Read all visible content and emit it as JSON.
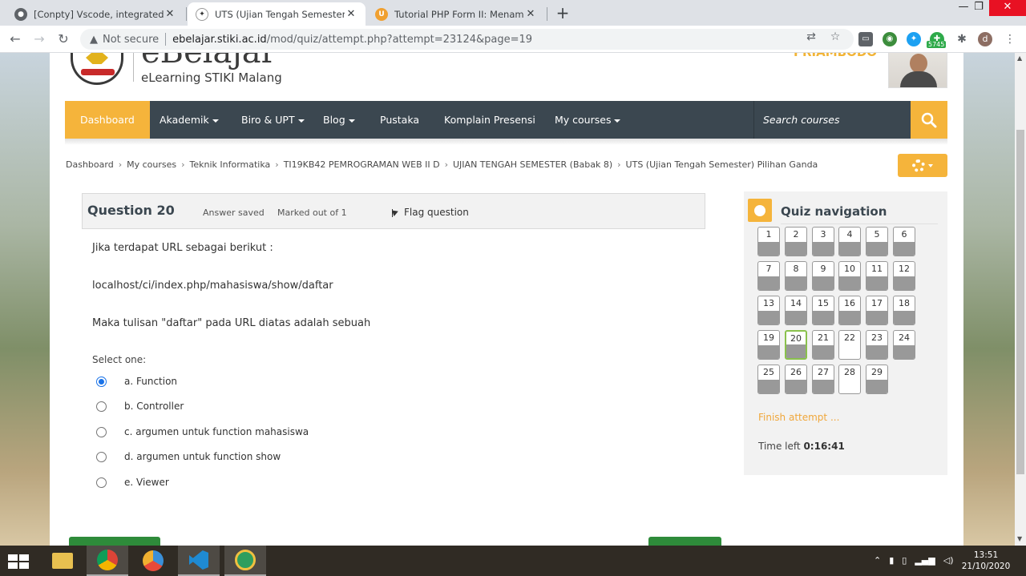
{
  "browser": {
    "tabs": [
      {
        "title": "[Conpty] Vscode, integrated term",
        "active": false
      },
      {
        "title": "UTS (Ujian Tengah Semester) Pilih",
        "active": true
      },
      {
        "title": "Tutorial PHP Form II: Menampilk",
        "active": false
      }
    ],
    "new_tab": "+",
    "window_controls": {
      "minimize": "—",
      "maximize": "❐",
      "close": "✕"
    },
    "security_label": "Not secure",
    "url_host": "ebelajar.stiki.ac.id",
    "url_path": "/mod/quiz/attempt.php?attempt=23124&page=19",
    "extension_badge": "5745",
    "profile_initial": "d"
  },
  "site": {
    "brand_name": "eBelajar",
    "brand_sub": "eLearning STIKI Malang",
    "user_name": "PRIAMBODO"
  },
  "navbar": {
    "items": [
      "Dashboard",
      "Akademik",
      "Biro & UPT",
      "Blog",
      "Pustaka",
      "Komplain Presensi",
      "My courses"
    ],
    "search_placeholder": "Search courses"
  },
  "breadcrumb": [
    "Dashboard",
    "My courses",
    "Teknik Informatika",
    "TI19KB42 PEMROGRAMAN WEB II D",
    "UJIAN TENGAH SEMESTER (Babak 8)",
    "UTS (Ujian Tengah Semester) Pilihan Ganda"
  ],
  "question": {
    "number_label": "Question 20",
    "state": "Answer saved",
    "grade": "Marked out of 1",
    "flag_label": "Flag question",
    "text_lines": [
      "Jika terdapat URL sebagai berikut :",
      "localhost/ci/index.php/mahasiswa/show/daftar",
      "Maka tulisan \"daftar\" pada URL diatas adalah sebuah"
    ],
    "select_one": "Select one:",
    "options": [
      {
        "label": "a. Function",
        "checked": true
      },
      {
        "label": "b. Controller",
        "checked": false
      },
      {
        "label": "c. argumen untuk function mahasiswa",
        "checked": false
      },
      {
        "label": "d. argumen untuk function show",
        "checked": false
      },
      {
        "label": "e. Viewer",
        "checked": false
      }
    ]
  },
  "quiz_nav": {
    "title": "Quiz navigation",
    "questions": [
      {
        "n": "1",
        "answered": true
      },
      {
        "n": "2",
        "answered": true
      },
      {
        "n": "3",
        "answered": true
      },
      {
        "n": "4",
        "answered": true
      },
      {
        "n": "5",
        "answered": true
      },
      {
        "n": "6",
        "answered": true
      },
      {
        "n": "7",
        "answered": true
      },
      {
        "n": "8",
        "answered": true
      },
      {
        "n": "9",
        "answered": true
      },
      {
        "n": "10",
        "answered": true
      },
      {
        "n": "11",
        "answered": true
      },
      {
        "n": "12",
        "answered": true
      },
      {
        "n": "13",
        "answered": true
      },
      {
        "n": "14",
        "answered": true
      },
      {
        "n": "15",
        "answered": true
      },
      {
        "n": "16",
        "answered": true
      },
      {
        "n": "17",
        "answered": true
      },
      {
        "n": "18",
        "answered": true
      },
      {
        "n": "19",
        "answered": true
      },
      {
        "n": "20",
        "answered": true,
        "current": true
      },
      {
        "n": "21",
        "answered": true
      },
      {
        "n": "22",
        "answered": false
      },
      {
        "n": "23",
        "answered": true
      },
      {
        "n": "24",
        "answered": true
      },
      {
        "n": "25",
        "answered": true
      },
      {
        "n": "26",
        "answered": true
      },
      {
        "n": "27",
        "answered": true
      },
      {
        "n": "28",
        "answered": false
      },
      {
        "n": "29",
        "answered": true
      }
    ],
    "finish_label": "Finish attempt ...",
    "time_left_label": "Time left",
    "time_left_value": "0:16:41"
  },
  "taskbar": {
    "time": "13:51",
    "date": "21/10/2020"
  },
  "colors": {
    "accent": "#f5b43b",
    "navbar_bg": "#3b4750",
    "current_question_border": "#8ac14d",
    "finish_link": "#f0a73b"
  }
}
